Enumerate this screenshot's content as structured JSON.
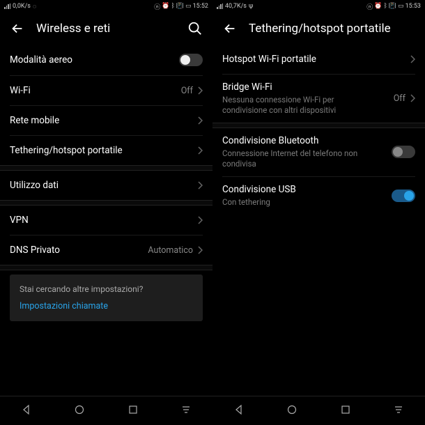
{
  "left": {
    "status": {
      "speed": "0,0K/s",
      "time": "15:52"
    },
    "title": "Wireless e reti",
    "airplane": "Modalità aereo",
    "wifi": {
      "label": "Wi-Fi",
      "value": "Off"
    },
    "mobile": "Rete mobile",
    "tethering": "Tethering/hotspot portatile",
    "data_usage": "Utilizzo dati",
    "vpn": "VPN",
    "dns": {
      "label": "DNS Privato",
      "value": "Automatico"
    },
    "search_card": {
      "title": "Stai cercando altre impostazioni?",
      "link": "Impostazioni chiamate"
    }
  },
  "right": {
    "status": {
      "speed": "40,7K/s",
      "time": "15:53"
    },
    "title": "Tethering/hotspot portatile",
    "hotspot": "Hotspot Wi-Fi portatile",
    "bridge": {
      "label": "Bridge Wi-Fi",
      "sub": "Nessuna connessione Wi-Fi per condivisione con altri dispositivi",
      "value": "Off"
    },
    "bt": {
      "label": "Condivisione Bluetooth",
      "sub": "Connessione Internet del telefono non condivisa"
    },
    "usb": {
      "label": "Condivisione USB",
      "sub": "Con tethering"
    }
  }
}
